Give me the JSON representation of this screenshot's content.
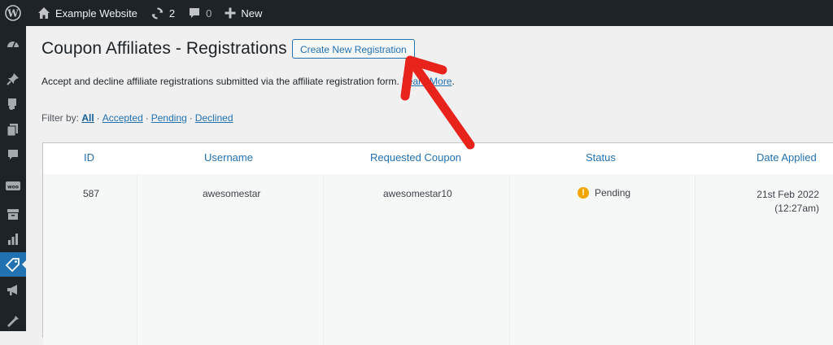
{
  "adminbar": {
    "site_name": "Example Website",
    "updates_count": "2",
    "comments_count": "0",
    "new_label": "New"
  },
  "sidebar": {
    "items": [
      "dashboard-icon",
      "pin-icon",
      "media-icon",
      "pages-icon",
      "comments-icon",
      "woo-icon",
      "archive-icon",
      "analytics-icon",
      "coupon-tag-icon",
      "megaphone-icon",
      "tools-icon"
    ],
    "active": "coupon-tag-icon"
  },
  "page": {
    "title": "Coupon Affiliates - Registrations",
    "create_button": "Create New Registration",
    "description_before": "Accept and decline affiliate registrations submitted via the affiliate registration form.",
    "learn_more": "Learn More",
    "description_after": "."
  },
  "filter": {
    "label": "Filter by:",
    "options": [
      "All",
      "Accepted",
      "Pending",
      "Declined"
    ],
    "current": "All"
  },
  "table": {
    "headers": [
      "ID",
      "Username",
      "Requested Coupon",
      "Status",
      "Date Applied"
    ],
    "rows": [
      {
        "id": "587",
        "username": "awesomestar",
        "coupon": "awesomestar10",
        "status": "Pending",
        "date": "21st Feb 2022",
        "time": "(12:27am)"
      }
    ]
  },
  "colors": {
    "adminbar_bg": "#1d2327",
    "accent": "#2271b1",
    "pending": "#f0a500",
    "annotation_arrow": "#e8231c"
  }
}
